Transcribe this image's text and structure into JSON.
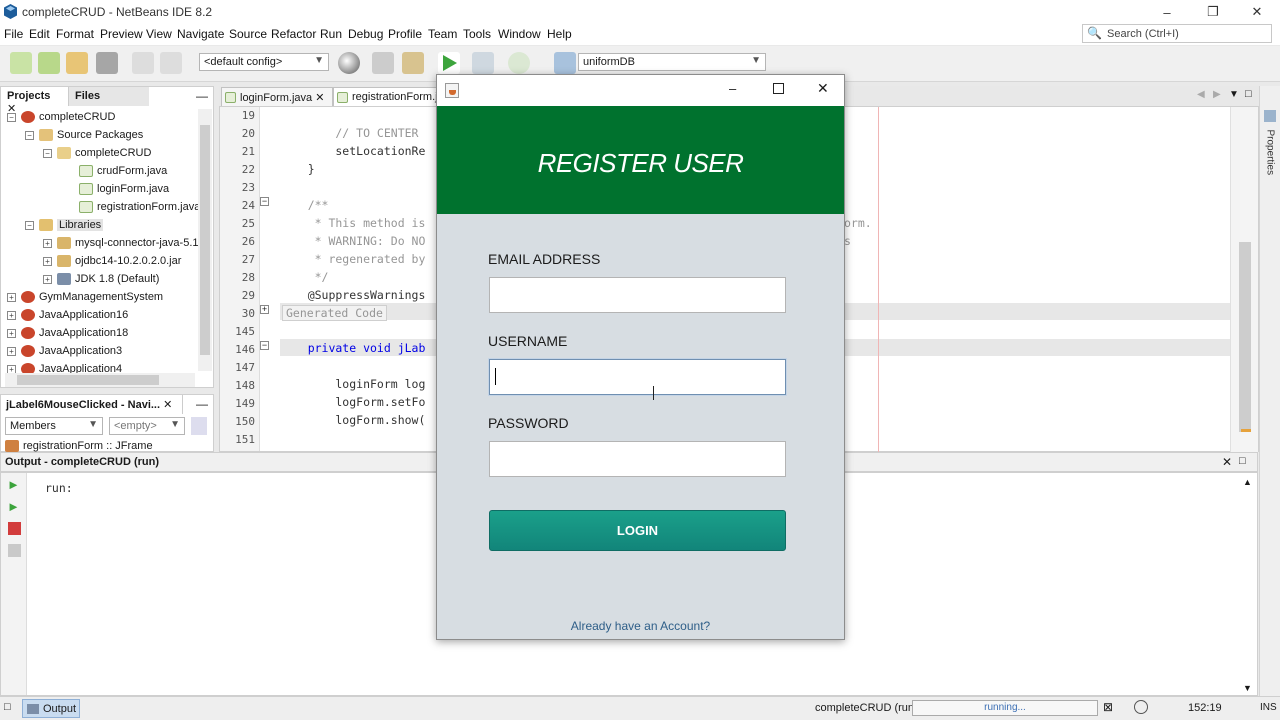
{
  "window": {
    "title": "completeCRUD - NetBeans IDE 8.2"
  },
  "menu": [
    "File",
    "Edit",
    "Format",
    "Preview",
    "View",
    "Navigate",
    "Source",
    "Refactor",
    "Run",
    "Debug",
    "Profile",
    "Team",
    "Tools",
    "Window",
    "Help"
  ],
  "search": {
    "placeholder": "Search (Ctrl+I)"
  },
  "toolbar": {
    "config": "<default config>",
    "db": "uniformDB"
  },
  "projects": {
    "tabs": [
      "Projects",
      "Files"
    ],
    "tree": [
      "completeCRUD",
      "Source Packages",
      "completeCRUD",
      "crudForm.java",
      "loginForm.java",
      "registrationForm.java",
      "Libraries",
      "mysql-connector-java-5.1",
      "ojdbc14-10.2.0.2.0.jar",
      "JDK 1.8 (Default)",
      "GymManagementSystem",
      "JavaApplication16",
      "JavaApplication18",
      "JavaApplication3",
      "JavaApplication4"
    ]
  },
  "navigator": {
    "title": "jLabel6MouseClicked - Navi...",
    "members": "Members",
    "filter": "<empty>",
    "item": "registrationForm :: JFrame"
  },
  "editor": {
    "tabs": [
      "loginForm.java",
      "registrationForm.ja"
    ],
    "line_numbers": [
      "19",
      "20",
      "21",
      "22",
      "23",
      "24",
      "25",
      "26",
      "27",
      "28",
      "29",
      "30",
      "145",
      "146",
      "147",
      "148",
      "149",
      "150",
      "151"
    ],
    "lines": [
      "",
      "        // TO CENTER",
      "        setLocationRe",
      "    }",
      "",
      "    /**",
      "     * This method is",
      "     * WARNING: Do NO",
      "     * regenerated by",
      "     */",
      "    @SuppressWarnings",
      "Generated Code",
      "",
      "    private void jLab",
      "",
      "        loginForm log",
      "        logForm.setFo",
      "        logForm.show(",
      ""
    ],
    "right_fragments": [
      "orm.",
      "s"
    ]
  },
  "output": {
    "title": "Output - completeCRUD (run)",
    "text": "run:"
  },
  "statusbar": {
    "output_tab": "Output",
    "project": "completeCRUD (run)",
    "progress": "running...",
    "position": "152:19",
    "mode": "INS"
  },
  "right_strip": {
    "label": "Properties"
  },
  "dialog": {
    "banner": "REGISTER USER",
    "email_label": "EMAIL ADDRESS",
    "email_value": "",
    "username_label": "USERNAME",
    "username_value": "",
    "password_label": "PASSWORD",
    "password_value": "",
    "login_button": "LOGIN",
    "already_link": "Already have an Account?"
  }
}
